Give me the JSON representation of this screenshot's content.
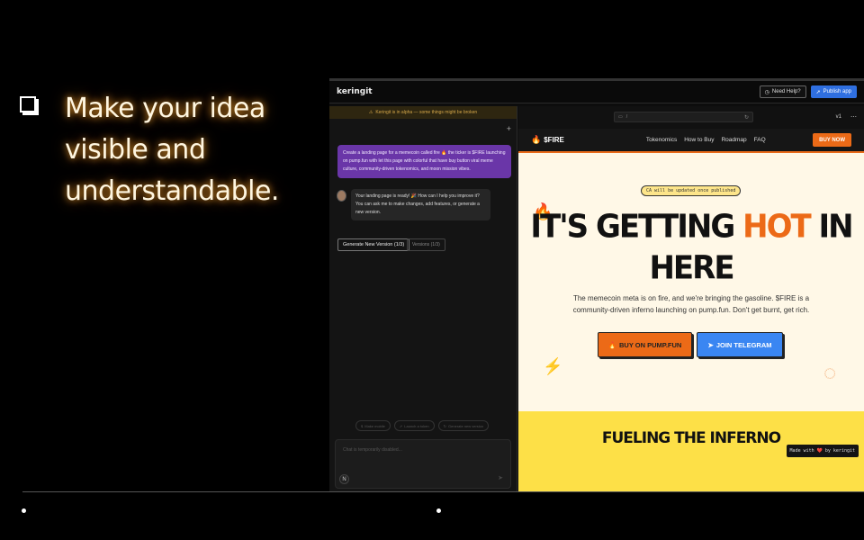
{
  "slide": {
    "lines": [
      "Make your idea",
      "visible and",
      "understandable."
    ]
  },
  "app": {
    "logo": "keringit",
    "help_label": "Need Help?",
    "publish_label": "Publish app",
    "alpha_notice": "Keringit is in alpha — some things might be broken",
    "user_message": "Create a landing page for a memecoin called fire 🔥 the ticker is $FIRE launching on pump.fun with let this page with colorful that have buy button viral meme culture, community-driven tokenomics, and moon mission vibes.",
    "ai_message": "Your landing page is ready! 🎉 How can I help you improve it? You can ask me to make changes, add features, or generate a new version.",
    "generate_label": "Generate New Version (1/3)",
    "versions_label": "Versions (1/3)",
    "chips": [
      "Make mobile",
      "Launch a token",
      "Generate new version"
    ],
    "chat_placeholder": "Chat is temporarily disabled...",
    "avatar_letter": "N",
    "url": "/",
    "version": "v1"
  },
  "site": {
    "brand": "$FIRE",
    "nav": [
      "Tokenomics",
      "How to Buy",
      "Roadmap",
      "FAQ"
    ],
    "buy_now": "BUY NOW",
    "ca_badge": "CA will be updated once published",
    "hero_pre": "IT'S GETTING ",
    "hero_hot": "HOT",
    "hero_post": " IN HERE",
    "hero_sub": "The memecoin meta is on fire, and we're bringing the gasoline. $FIRE is a community-driven inferno launching on pump.fun. Don't get burnt, get rich.",
    "cta_buy": "BUY ON PUMP.FUN",
    "cta_telegram": "JOIN TELEGRAM",
    "section_title": "FUELING THE INFERNO",
    "made_with": "Made with ❤️ by keringit"
  },
  "colors": {
    "accent": "#ec6a17",
    "publish": "#2f6fe0",
    "yellow": "#fde047",
    "purple": "#6a36a8"
  }
}
